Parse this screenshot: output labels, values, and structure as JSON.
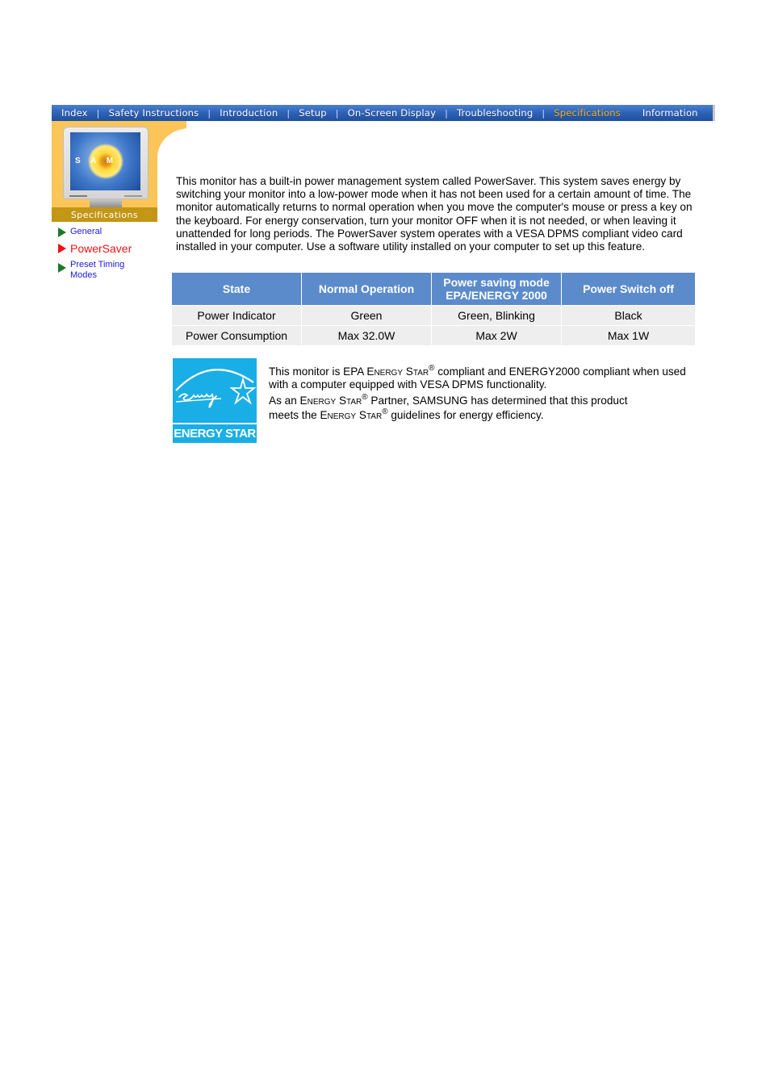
{
  "nav": {
    "items": [
      {
        "label": "Index",
        "active": false
      },
      {
        "label": "Safety Instructions",
        "active": false
      },
      {
        "label": "Introduction",
        "active": false
      },
      {
        "label": "Setup",
        "active": false
      },
      {
        "label": "On-Screen Display",
        "active": false
      },
      {
        "label": "Troubleshooting",
        "active": false
      },
      {
        "label": "Specifications",
        "active": true
      },
      {
        "label": "Information",
        "active": false
      }
    ],
    "separator": "|",
    "active_color": "#f5b21f"
  },
  "side_panel": {
    "monitor_brand_text": "S A M",
    "section_label": "Specifications"
  },
  "side_menu": {
    "items": [
      {
        "label": "General",
        "current": false
      },
      {
        "label": "PowerSaver",
        "current": true
      },
      {
        "label": "Preset Timing Modes",
        "current": false
      }
    ]
  },
  "intro": {
    "text": "This monitor has a built-in power management system called PowerSaver. This system saves energy by switching your monitor into a low-power mode when it has not been used for a certain amount of time. The monitor automatically returns to normal operation when you move the computer's mouse or press a key on the keyboard. For energy conservation, turn your monitor OFF when it is not needed, or when leaving it unattended for long periods. The PowerSaver system operates with a VESA DPMS compliant video card installed in your computer. Use a software utility installed on your computer to set up this feature."
  },
  "power_table": {
    "headers": [
      "State",
      "Normal Operation",
      "Power saving mode EPA/ENERGY 2000",
      "Power Switch off"
    ],
    "header_lines": [
      [
        "State"
      ],
      [
        "Normal Operation"
      ],
      [
        "Power saving mode",
        "EPA/ENERGY 2000"
      ],
      [
        "Power Switch off"
      ]
    ],
    "rows": [
      [
        "Power Indicator",
        "Green",
        "Green, Blinking",
        "Black"
      ],
      [
        "Power Consumption",
        "Max 32.0W",
        "Max 2W",
        "Max 1W"
      ]
    ],
    "header_color": "#5b8bcb"
  },
  "energy_star": {
    "logo_script": "energy",
    "logo_label": "ENERGY STAR",
    "logo_color": "#1aaee6",
    "p1": {
      "pre": "This monitor is EPA ",
      "brand": "Energy Star",
      "reg": "®",
      "post": " compliant and ENERGY2000 compliant when used with a computer equipped with VESA DPMS functionality."
    },
    "p2": {
      "pre": "As an ",
      "brand": "Energy Star",
      "reg": "®",
      "post": " Partner, SAMSUNG has determined that this product"
    },
    "p3": {
      "pre": "meets the ",
      "brand": "Energy Star",
      "reg": "®",
      "post": " guidelines for energy efficiency."
    }
  }
}
